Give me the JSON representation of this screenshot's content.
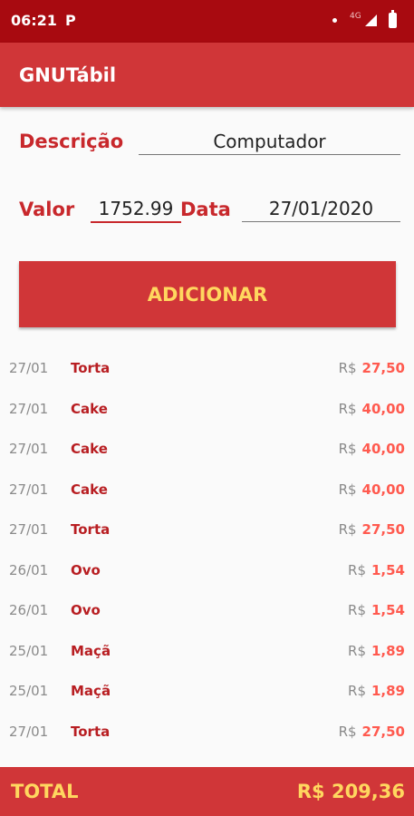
{
  "status_bar": {
    "time": "06:21",
    "notification_icon": "P",
    "network": "4G"
  },
  "app": {
    "title": "GNUTábil"
  },
  "form": {
    "descricao_label": "Descrição",
    "descricao_value": "Computador",
    "valor_label": "Valor",
    "valor_value": "1752.99",
    "data_label": "Data",
    "data_value": "27/01/2020",
    "add_button_label": "ADICIONAR"
  },
  "entries": [
    {
      "date": "27/01",
      "name": "Torta",
      "currency": "R$",
      "value": "27,50"
    },
    {
      "date": "27/01",
      "name": "Cake",
      "currency": "R$",
      "value": "40,00"
    },
    {
      "date": "27/01",
      "name": "Cake",
      "currency": "R$",
      "value": "40,00"
    },
    {
      "date": "27/01",
      "name": "Cake",
      "currency": "R$",
      "value": "40,00"
    },
    {
      "date": "27/01",
      "name": "Torta",
      "currency": "R$",
      "value": "27,50"
    },
    {
      "date": "26/01",
      "name": "Ovo",
      "currency": "R$",
      "value": "1,54"
    },
    {
      "date": "26/01",
      "name": "Ovo",
      "currency": "R$",
      "value": "1,54"
    },
    {
      "date": "25/01",
      "name": "Maçã",
      "currency": "R$",
      "value": "1,89"
    },
    {
      "date": "25/01",
      "name": "Maçã",
      "currency": "R$",
      "value": "1,89"
    },
    {
      "date": "27/01",
      "name": "Torta",
      "currency": "R$",
      "value": "27,50"
    }
  ],
  "footer": {
    "total_label": "TOTAL",
    "total_value": "R$ 209,36"
  },
  "colors": {
    "status_bar": "#a80a10",
    "primary": "#d03638",
    "accent_text": "#ffd75f",
    "label_red": "#c8282c",
    "value_red": "#ff5a4f"
  }
}
